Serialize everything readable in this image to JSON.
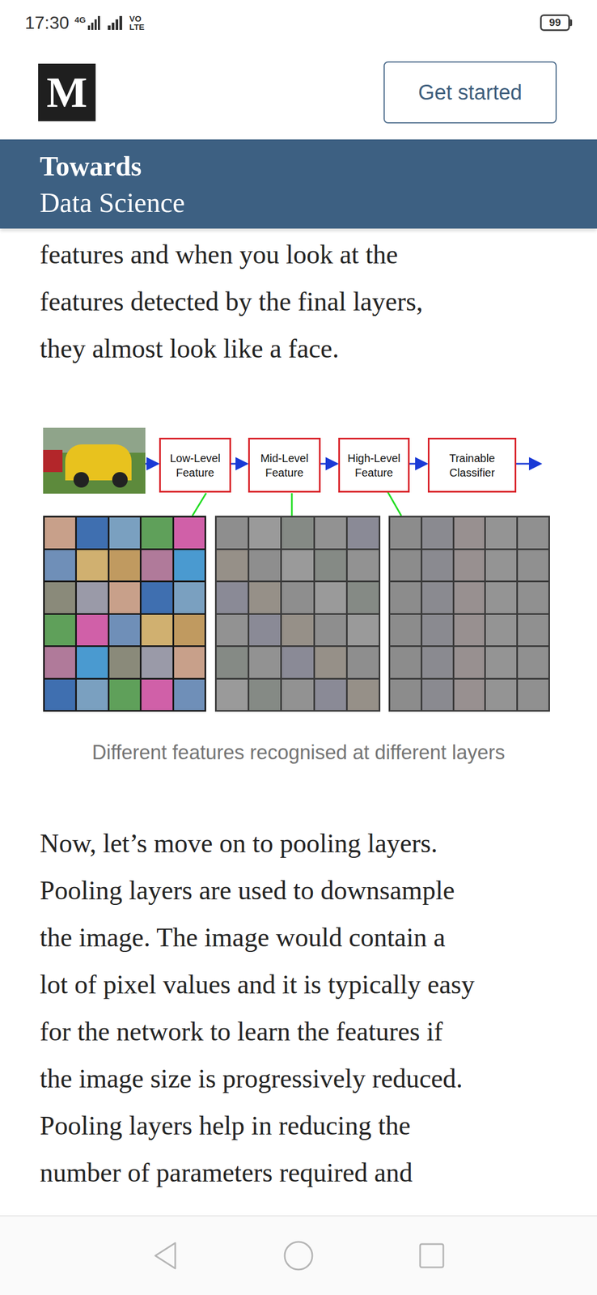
{
  "status_bar": {
    "time": "17:30",
    "network": "4G",
    "volte_top": "VO",
    "volte_bottom": "LTE",
    "battery": "99"
  },
  "header": {
    "logo": "M",
    "button": "Get started"
  },
  "publication": {
    "line1": "Towards",
    "line2": "Data Science"
  },
  "article": {
    "intro_lines": [
      "features and when you look at the",
      "features detected by the final layers,",
      "they almost look like a face."
    ],
    "figure": {
      "stages": [
        {
          "lines": [
            "Low-Level",
            "Feature"
          ]
        },
        {
          "lines": [
            "Mid-Level",
            "Feature"
          ]
        },
        {
          "lines": [
            "High-Level",
            "Feature"
          ]
        },
        {
          "lines": [
            "Trainable",
            "Classifier"
          ]
        }
      ],
      "caption": "Different features recognised at different layers"
    },
    "paragraph_lines": [
      "Now, let’s move on to pooling layers.",
      "Pooling layers are used to downsample",
      "the image. The image would contain a",
      "lot of pixel values and it is typically easy",
      "for the network to learn the features if",
      "the image size is progressively reduced.",
      "Pooling layers help in reducing the",
      "number of parameters required and"
    ]
  }
}
